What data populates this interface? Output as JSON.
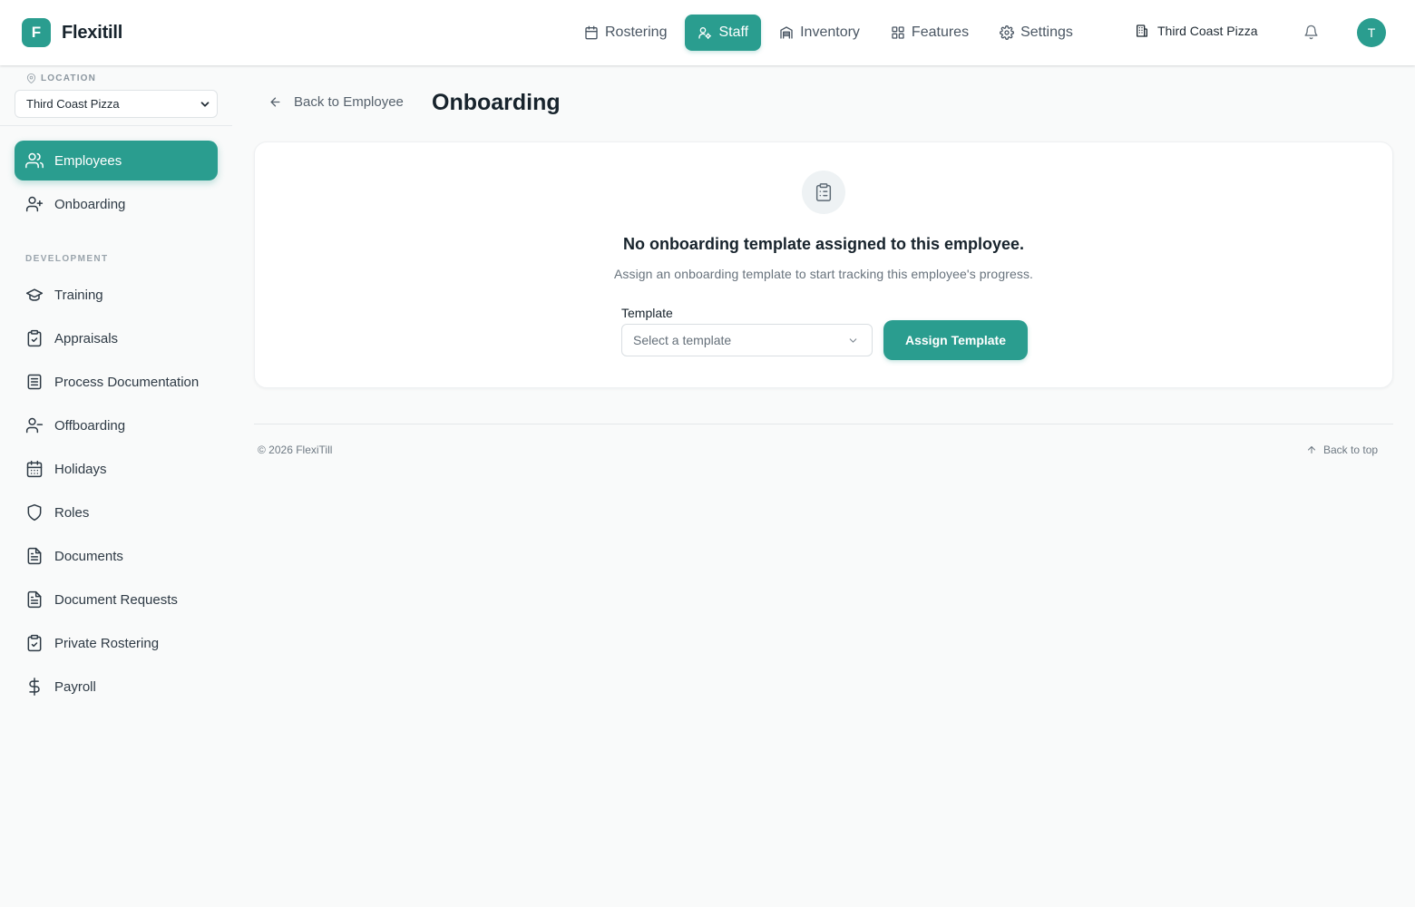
{
  "app": {
    "logo_letter": "F",
    "name": "Flexitill",
    "accent_color": "#2a9d8f"
  },
  "topnav": {
    "items": [
      {
        "label": "Rostering",
        "icon": "calendar-icon",
        "active": false
      },
      {
        "label": "Staff",
        "icon": "staff-icon",
        "active": true
      },
      {
        "label": "Inventory",
        "icon": "inventory-icon",
        "active": false
      },
      {
        "label": "Features",
        "icon": "grid-icon",
        "active": false
      },
      {
        "label": "Settings",
        "icon": "gear-icon",
        "active": false
      }
    ],
    "location": "Third Coast Pizza",
    "avatar_initial": "T"
  },
  "sidebar": {
    "location_label": "LOCATION",
    "location_value": "Third Coast Pizza",
    "items": [
      {
        "label": "Employees",
        "icon": "users-icon",
        "active": true
      },
      {
        "label": "Onboarding",
        "icon": "user-plus-icon",
        "active": false
      }
    ],
    "section_label": "DEVELOPMENT",
    "dev_items": [
      {
        "label": "Training",
        "icon": "graduation-cap-icon"
      },
      {
        "label": "Appraisals",
        "icon": "clipboard-check-icon"
      },
      {
        "label": "Process Documentation",
        "icon": "document-icon"
      },
      {
        "label": "Offboarding",
        "icon": "user-minus-icon"
      },
      {
        "label": "Holidays",
        "icon": "calendar-days-icon"
      },
      {
        "label": "Roles",
        "icon": "shield-icon"
      },
      {
        "label": "Documents",
        "icon": "file-text-icon"
      },
      {
        "label": "Document Requests",
        "icon": "file-text-icon"
      },
      {
        "label": "Private Rostering",
        "icon": "clipboard-check-icon"
      },
      {
        "label": "Payroll",
        "icon": "dollar-icon"
      }
    ]
  },
  "header": {
    "back_label": "Back to Employee",
    "title": "Onboarding"
  },
  "empty_state": {
    "icon": "clipboard-list-icon",
    "title": "No onboarding template assigned to this employee.",
    "subtitle": "Assign an onboarding template to start tracking this employee's progress.",
    "template_label": "Template",
    "template_placeholder": "Select a template",
    "assign_button": "Assign Template"
  },
  "footer": {
    "copyright": "© 2026 FlexiTill",
    "back_to_top": "Back to top"
  }
}
